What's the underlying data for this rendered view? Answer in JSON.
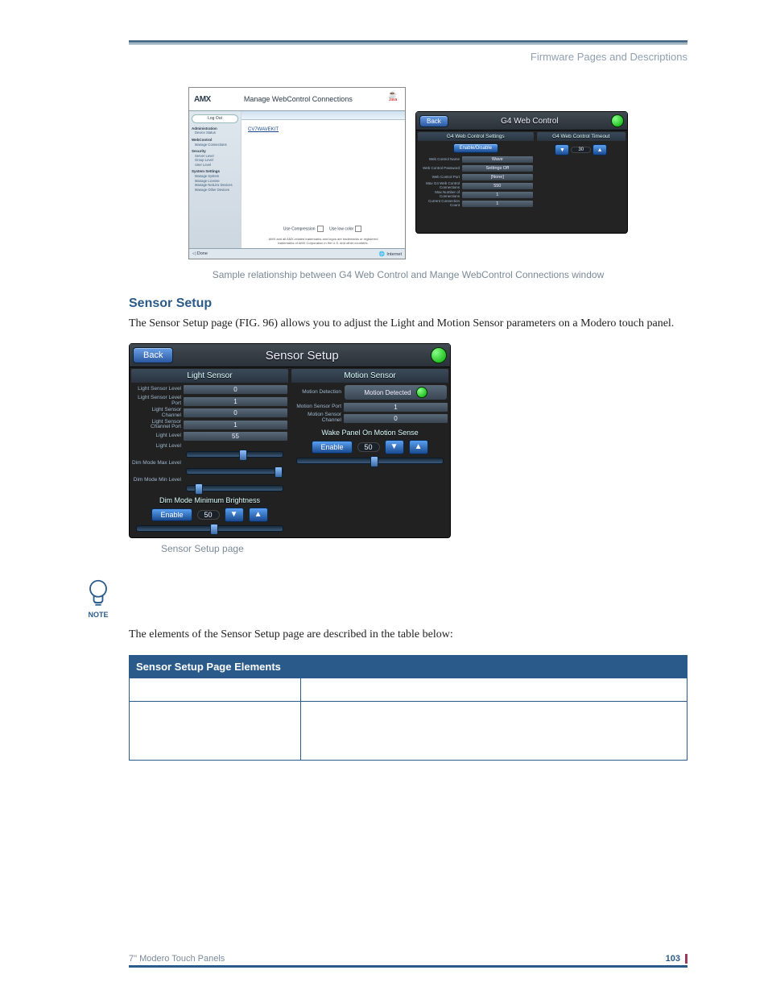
{
  "running_head": "Firmware Pages and Descriptions",
  "fig1": {
    "logo": "AMX",
    "title": "Manage WebControl Connections",
    "java": "Java",
    "side_pill": "Log Out",
    "side_groups": [
      {
        "h": "Administration",
        "items": [
          "Device Status"
        ]
      },
      {
        "h": "WebControl",
        "items": [
          "Manage Connections"
        ]
      },
      {
        "h": "Security",
        "items": [
          "Server Level",
          "Group Level",
          "User Level"
        ]
      },
      {
        "h": "System Settings",
        "items": [
          "Manage System",
          "Manage License",
          "Manage NetLinx Devices",
          "Manage Other Devices"
        ]
      }
    ],
    "link": "CV7WAVEKIT",
    "check1": "Use Compression",
    "check2": "Use low color",
    "legal1": "AMX and all AMX-related trademarks and logos are trademarks or registered",
    "legal2": "trademarks of AMX Corporation in the U.S. and other countries.",
    "status_left": "Done",
    "status_right": "Internet"
  },
  "fig2": {
    "back": "Back",
    "title": "G4 Web Control",
    "left_hdr": "G4 Web Control Settings",
    "right_hdr": "G4 Web Control Timeout",
    "enable": "Enable/Disable",
    "timeout_val": "30",
    "rows": [
      {
        "l": "Web Control Name",
        "v": "Wave"
      },
      {
        "l": "Web Control Password",
        "v": "Settings Off"
      },
      {
        "l": "Web Control Port",
        "v": "[None]"
      },
      {
        "l": "Max G4 Web Control Connections",
        "v": "550"
      },
      {
        "l": "Max Number of Connections",
        "v": "1"
      },
      {
        "l": "Current Connection Count",
        "v": "1"
      }
    ]
  },
  "caption1": "Sample relationship between G4 Web Control and Mange WebControl Connections window",
  "section_title": "Sensor Setup",
  "paragraph1": "The Sensor Setup page (FIG. 96) allows you to adjust the Light and Motion Sensor parameters on a Modero touch panel.",
  "fig3": {
    "back": "Back",
    "title": "Sensor Setup",
    "left_hdr": "Light Sensor",
    "right_hdr": "Motion Sensor",
    "light_rows": [
      {
        "l": "Light Sensor Level",
        "v": "0"
      },
      {
        "l": "Light Sensor Level Port",
        "v": "1"
      },
      {
        "l": "Light Sensor Channel",
        "v": "0"
      },
      {
        "l": "Light Sensor Channel Port",
        "v": "1"
      },
      {
        "l": "Light Level",
        "v": "55"
      }
    ],
    "light_level_lbl": "Light Level",
    "dim_max_lbl": "Dim Mode Max Level",
    "dim_min_lbl": "Dim Mode Min Level",
    "dim_title": "Dim Mode Minimum Brightness",
    "dim_enable": "Enable",
    "dim_val": "50",
    "motion_rows": [
      {
        "l": "Motion Detection",
        "status": "Motion Detected"
      },
      {
        "l": "Motion Sensor Port",
        "v": "1"
      },
      {
        "l": "Motion Sensor Channel",
        "v": "0"
      }
    ],
    "wake_title": "Wake Panel On Motion Sense",
    "wake_enable": "Enable",
    "wake_val": "50"
  },
  "caption2": "Sensor Setup page",
  "note_label": "NOTE",
  "paragraph2": "The elements of the Sensor Setup page are described in the table below:",
  "table_header": "Sensor Setup Page Elements",
  "footer_left": "7\" Modero Touch Panels",
  "footer_page": "103"
}
